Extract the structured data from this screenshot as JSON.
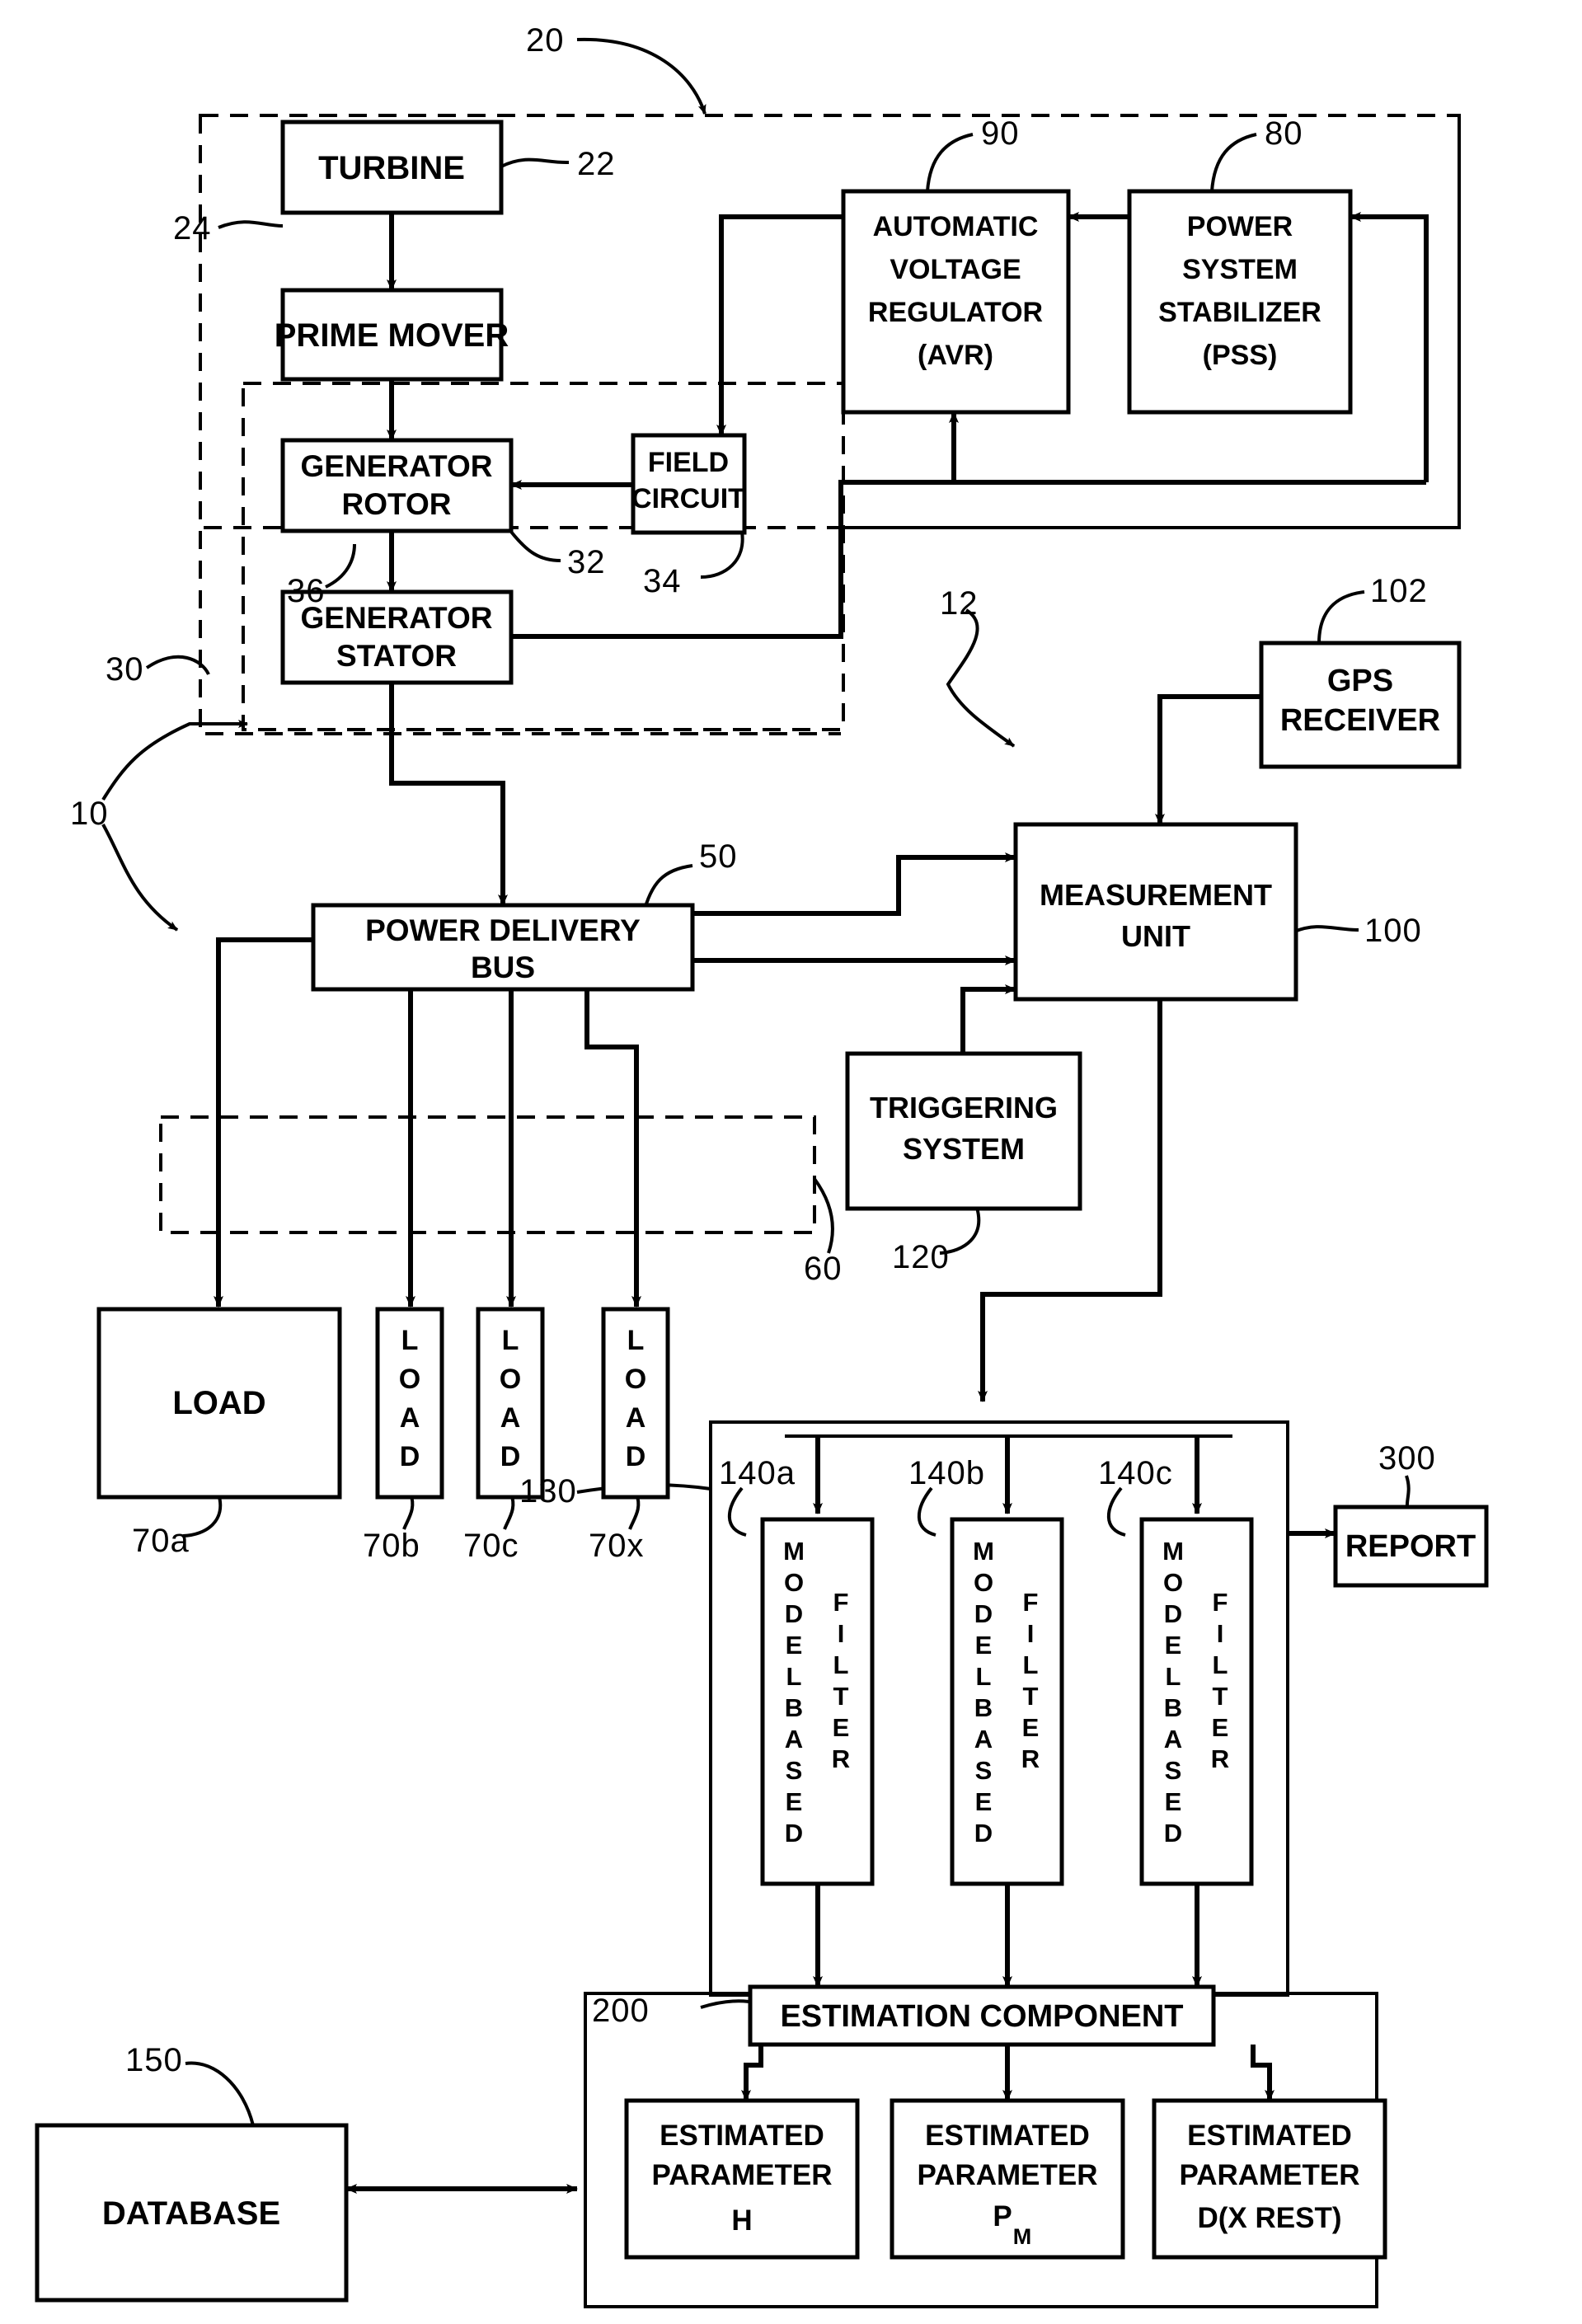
{
  "figure": {
    "title": "Power system parameter estimation block diagram",
    "background_color": "#ffffff",
    "line_color": "#000000"
  },
  "blocks": {
    "turbine": {
      "label": "TURBINE",
      "ref": "22"
    },
    "prime_mover": {
      "label": "PRIME MOVER",
      "ref": "24"
    },
    "generator_rotor": {
      "label_line1": "GENERATOR",
      "label_line2": "ROTOR",
      "ref": "32"
    },
    "generator_stator": {
      "label_line1": "GENERATOR",
      "label_line2": "STATOR",
      "ref": "36"
    },
    "field_circuit": {
      "label_line1": "FIELD",
      "label_line2": "CIRCUIT",
      "ref": "34"
    },
    "avr": {
      "label_line1": "AUTOMATIC",
      "label_line2": "VOLTAGE",
      "label_line3": "REGULATOR",
      "label_line4": "(AVR)",
      "ref": "90"
    },
    "pss": {
      "label_line1": "POWER",
      "label_line2": "SYSTEM",
      "label_line3": "STABILIZER",
      "label_line4": "(PSS)",
      "ref": "80"
    },
    "gps_receiver": {
      "label_line1": "GPS",
      "label_line2": "RECEIVER",
      "ref": "102"
    },
    "measurement_unit": {
      "label_line1": "MEASUREMENT",
      "label_line2": "UNIT",
      "ref": "100"
    },
    "triggering_system": {
      "label_line1": "TRIGGERING",
      "label_line2": "SYSTEM",
      "ref": "120"
    },
    "power_delivery_bus": {
      "label_line1": "POWER DELIVERY",
      "label_line2": "BUS",
      "ref": "50"
    },
    "load_a": {
      "label": "LOAD",
      "ref": "70a"
    },
    "load_b": {
      "label": "LOAD",
      "ref": "70b"
    },
    "load_c": {
      "label": "LOAD",
      "ref": "70c"
    },
    "load_x": {
      "label": "LOAD",
      "ref": "70x"
    },
    "filter_a": {
      "label_left": "MODELBASED",
      "label_right": "FILTER",
      "ref": "140a"
    },
    "filter_b": {
      "label_left": "MODELBASED",
      "label_right": "FILTER",
      "ref": "140b"
    },
    "filter_c": {
      "label_left": "MODELBASED",
      "label_right": "FILTER",
      "ref": "140c"
    },
    "estimation_component": {
      "label": "ESTIMATION COMPONENT",
      "ref": "200"
    },
    "estimated_parameter_h": {
      "label_line1": "ESTIMATED",
      "label_line2": "PARAMETER",
      "label_line3": "H"
    },
    "estimated_parameter_pm": {
      "label_line1": "ESTIMATED",
      "label_line2": "PARAMETER",
      "label_line3": "P",
      "label_line3_sub": "M"
    },
    "estimated_parameter_d": {
      "label_line1": "ESTIMATED",
      "label_line2": "PARAMETER",
      "label_line3": "D(X REST)"
    },
    "report": {
      "label": "REPORT",
      "ref": "300"
    },
    "database": {
      "label": "DATABASE",
      "ref": "150"
    }
  },
  "group_refs": {
    "system_20": "20",
    "generator_30": "30",
    "overall_10": "10",
    "monitoring_12": "12",
    "loads_60": "60",
    "analysis_130": "130"
  }
}
